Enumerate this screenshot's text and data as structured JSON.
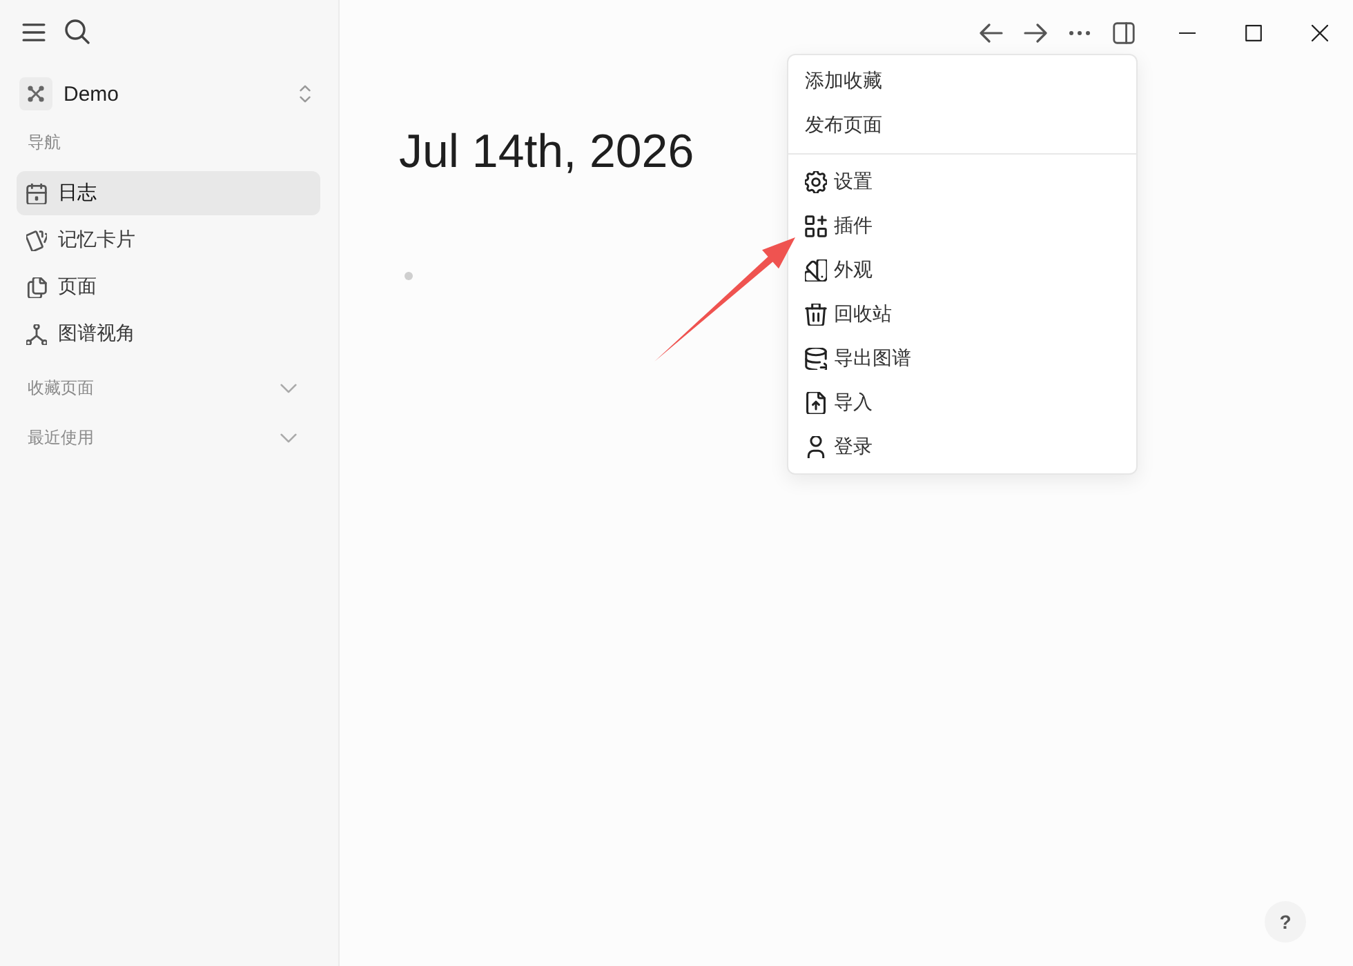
{
  "sidebar": {
    "workspace": {
      "name": "Demo"
    },
    "nav_heading": "导航",
    "nav_items": [
      {
        "label": "日志",
        "kind": "journal",
        "selected": true
      },
      {
        "label": "记忆卡片",
        "kind": "flashcards",
        "selected": false
      },
      {
        "label": "页面",
        "kind": "pages",
        "selected": false
      },
      {
        "label": "图谱视角",
        "kind": "graph",
        "selected": false
      }
    ],
    "sections": [
      {
        "label": "收藏页面",
        "expanded": false
      },
      {
        "label": "最近使用",
        "expanded": false
      }
    ]
  },
  "page": {
    "title": "Jul 14th, 2026"
  },
  "menu": {
    "groups": [
      {
        "items": [
          {
            "label": "添加收藏",
            "kind": "plain"
          },
          {
            "label": "发布页面",
            "kind": "plain"
          }
        ]
      },
      {
        "items": [
          {
            "label": "设置",
            "kind": "settings"
          },
          {
            "label": "插件",
            "kind": "plugins"
          },
          {
            "label": "外观",
            "kind": "appearance"
          },
          {
            "label": "回收站",
            "kind": "trash"
          },
          {
            "label": "导出图谱",
            "kind": "export"
          },
          {
            "label": "导入",
            "kind": "import"
          },
          {
            "label": "登录",
            "kind": "login"
          }
        ]
      }
    ]
  },
  "help_button": {
    "label": "?"
  }
}
